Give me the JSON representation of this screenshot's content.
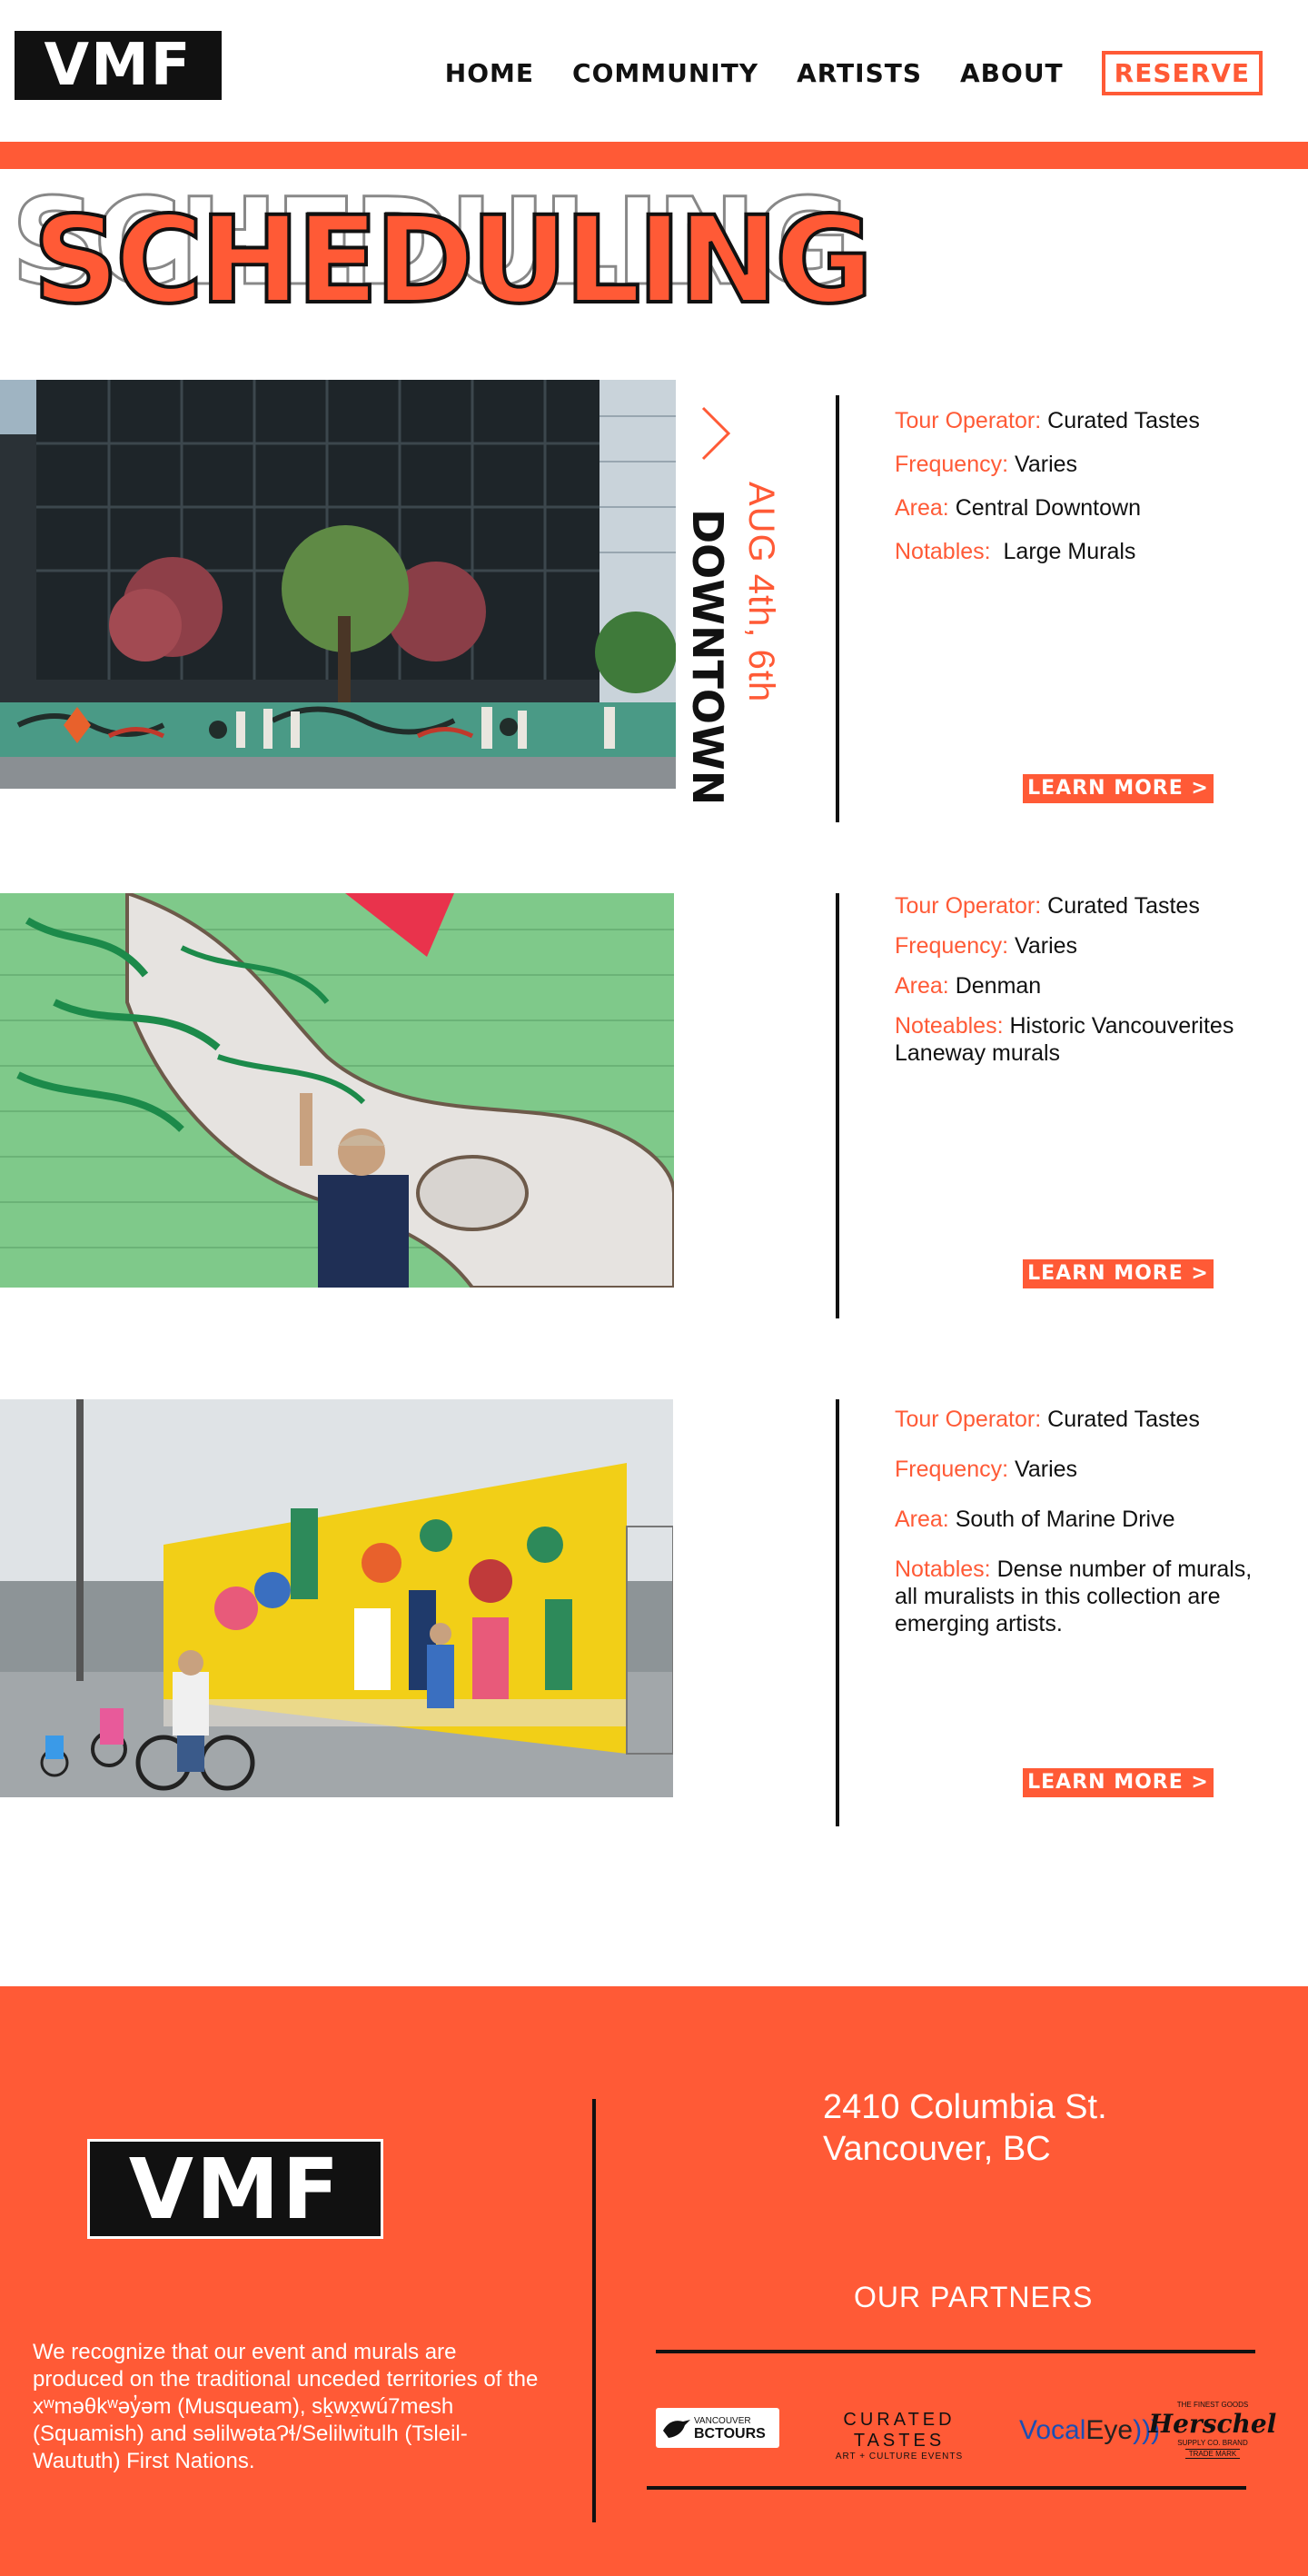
{
  "header": {
    "logo_text": "VMF",
    "nav": [
      {
        "label": "HOME"
      },
      {
        "label": "COMMUNITY"
      },
      {
        "label": "ARTISTS"
      },
      {
        "label": "ABOUT"
      }
    ],
    "reserve_label": "RESERVE"
  },
  "page": {
    "title": "SCHEDULING",
    "featured_date": "AUG 4th, 6th",
    "featured_place": "DOWNTOWN"
  },
  "tours": [
    {
      "rows": [
        {
          "label": "Tour Operator:",
          "value": "Curated Tastes"
        },
        {
          "label": "Frequency:",
          "value": "Varies"
        },
        {
          "label": "Area:",
          "value": "Central Downtown"
        },
        {
          "label": "Notables:",
          "value": " Large Murals"
        }
      ],
      "button": "LEARN MORE >"
    },
    {
      "rows": [
        {
          "label": "Tour Operator:",
          "value": "Curated Tastes"
        },
        {
          "label": "Frequency:",
          "value": "Varies"
        },
        {
          "label": "Area:",
          "value": "Denman"
        },
        {
          "label": "Noteables:",
          "value": "Historic Vancouverites Laneway murals"
        }
      ],
      "button": "LEARN MORE >"
    },
    {
      "rows": [
        {
          "label": "Tour Operator:",
          "value": "Curated Tastes"
        },
        {
          "label": "Frequency:",
          "value": "Varies"
        },
        {
          "label": "Area:",
          "value": "South of Marine Drive"
        },
        {
          "label": "Notables:",
          "value": "Dense number of murals, all muralists in this collection are emerging artists."
        }
      ],
      "button": "LEARN MORE >"
    }
  ],
  "footer": {
    "logo_text": "VMF",
    "acknowledgement": "We recognize that our event and murals are produced on the traditional unceded territories of the xʷməθkʷəy̓əm (Musqueam), sḵwx̱wú7mesh (Squamish) and səlilwətaɁɬ/Selilwitulh (Tsleil-Waututh) First Nations.",
    "address_line1": "2410 Columbia St.",
    "address_line2": "Vancouver, BC",
    "partners_title": "OUR PARTNERS",
    "partners": {
      "vbc_small": "VANCOUVER",
      "vbc_big": "BCTOURS",
      "curated_main": "CURATED TASTES",
      "curated_sub": "ART + CULTURE EVENTS",
      "vocal_a": "Vocal",
      "vocal_b": "Eye",
      "vocal_waves": ")))",
      "herschel_top": "THE FINEST GOODS",
      "herschel_name": "Herschel",
      "herschel_sub": "SUPPLY CO. BRAND",
      "herschel_tm": "TRADE MARK"
    }
  },
  "colors": {
    "accent": "#ff5a36",
    "ink": "#111111"
  }
}
